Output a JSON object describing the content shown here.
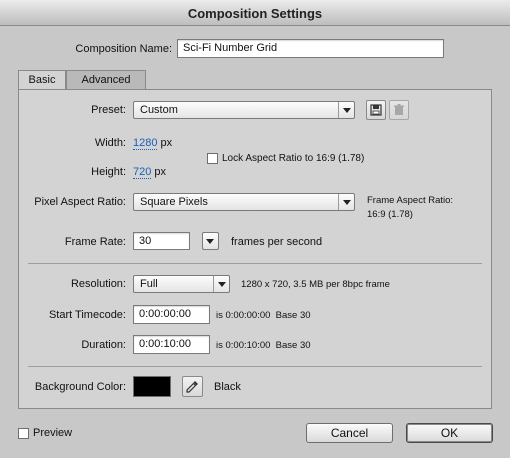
{
  "window": {
    "title": "Composition Settings"
  },
  "composition_name": {
    "label": "Composition Name:",
    "value": "Sci-Fi Number Grid"
  },
  "tabs": [
    {
      "label": "Basic",
      "active": true
    },
    {
      "label": "Advanced",
      "active": false
    }
  ],
  "preset": {
    "label": "Preset:",
    "value": "Custom"
  },
  "width": {
    "label": "Width:",
    "value": "1280",
    "unit": "px"
  },
  "height": {
    "label": "Height:",
    "value": "720",
    "unit": "px"
  },
  "lock_aspect": {
    "label": "Lock Aspect Ratio to 16:9 (1.78)",
    "checked": false
  },
  "pixel_aspect": {
    "label": "Pixel Aspect Ratio:",
    "value": "Square Pixels"
  },
  "frame_aspect": {
    "label": "Frame Aspect Ratio:",
    "value": "16:9 (1.78)"
  },
  "frame_rate": {
    "label": "Frame Rate:",
    "value": "30",
    "unit": "frames per second"
  },
  "resolution": {
    "label": "Resolution:",
    "value": "Full",
    "info": "1280 x 720, 3.5 MB per 8bpc frame"
  },
  "start_timecode": {
    "label": "Start Timecode:",
    "value": "0:00:00:00",
    "info": "is 0:00:00:00  Base 30"
  },
  "duration": {
    "label": "Duration:",
    "value": "0:00:10:00",
    "info": "is 0:00:10:00  Base 30"
  },
  "background_color": {
    "label": "Background Color:",
    "swatch": "#000000",
    "name": "Black"
  },
  "footer": {
    "preview_label": "Preview",
    "preview_checked": false,
    "cancel_label": "Cancel",
    "ok_label": "OK"
  },
  "icons": {
    "preset_save": "save-preset-icon",
    "preset_delete": "trash-icon",
    "eyedropper": "eyedropper-icon"
  }
}
